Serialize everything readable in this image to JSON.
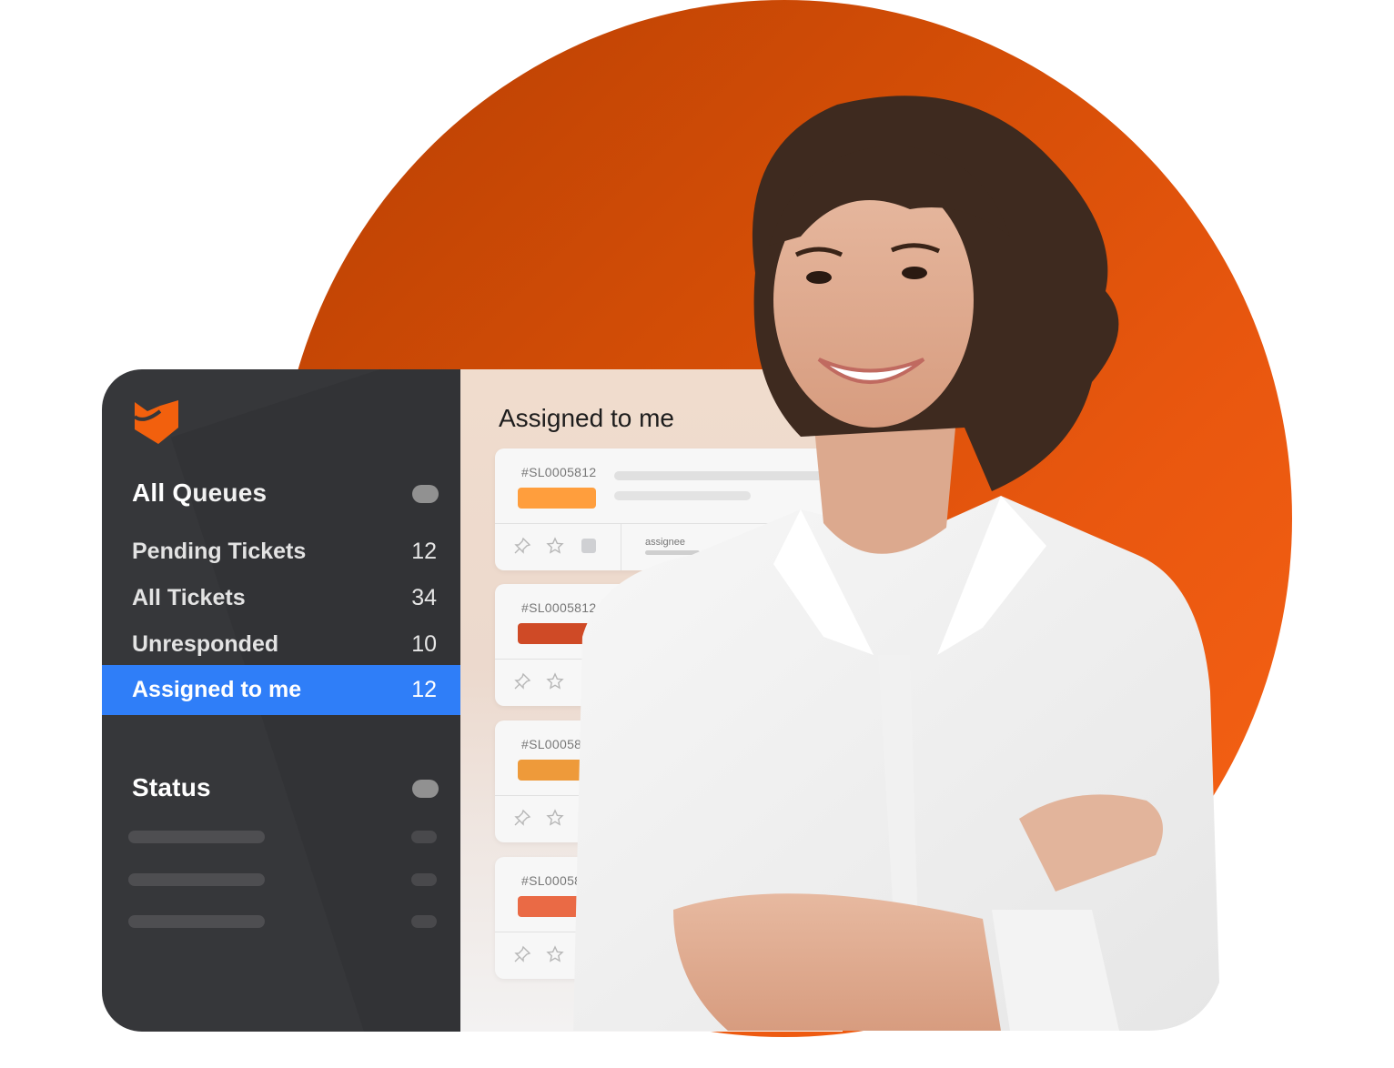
{
  "brand": {
    "logo_icon": "fox-logo-icon",
    "accent_color": "#f26419",
    "active_color": "#2f7ef8",
    "sidebar_color": "#36373a"
  },
  "sidebar": {
    "queues_section": {
      "title": "All Queues",
      "items": [
        {
          "label": "Pending Tickets",
          "count": "12",
          "active": false
        },
        {
          "label": "All Tickets",
          "count": "34",
          "active": false
        },
        {
          "label": "Unresponded",
          "count": "10",
          "active": false
        },
        {
          "label": "Assigned to me",
          "count": "12",
          "active": true
        }
      ]
    },
    "status_section": {
      "title": "Status"
    }
  },
  "main": {
    "title": "Assigned to me",
    "tickets": [
      {
        "id": "#SL0005812",
        "tag_color": "#ff9e3d",
        "assignee_label": "assignee"
      },
      {
        "id": "#SL0005812",
        "tag_color": "#cf4a26",
        "assignee_label": ""
      },
      {
        "id": "#SL0005812",
        "tag_color": "#ee9a3a",
        "assignee_label": ""
      },
      {
        "id": "#SL0005812",
        "tag_color": "#ea6a45",
        "assignee_label": ""
      }
    ],
    "ticket_icons": [
      "pin-icon",
      "star-icon",
      "tag-icon"
    ]
  }
}
